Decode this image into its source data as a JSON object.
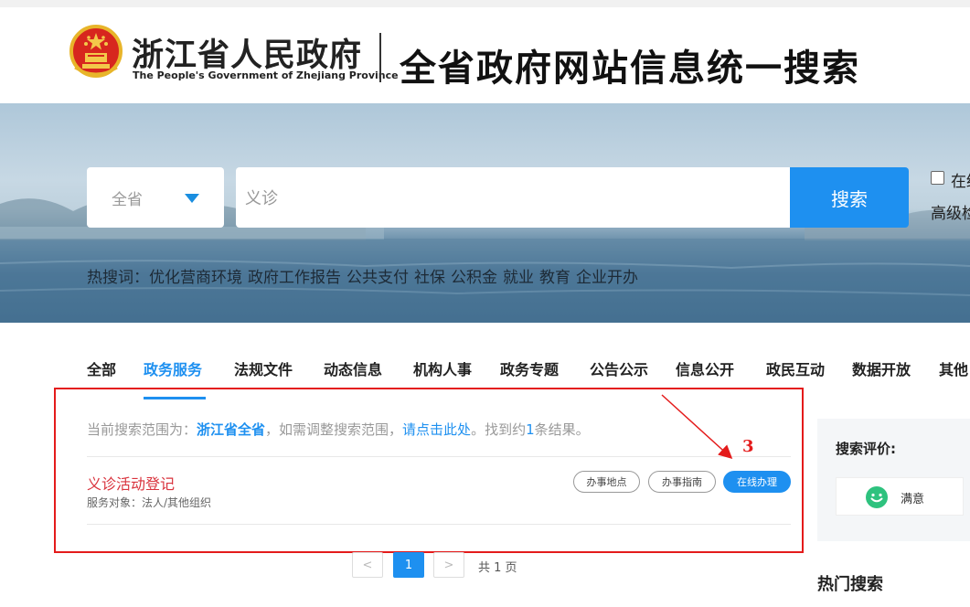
{
  "header": {
    "org_name_cn": "浙江省人民政府",
    "org_name_en": "The People's Government of Zhejiang Province",
    "site_title": "全省政府网站信息统一搜索"
  },
  "search": {
    "scope": "全省",
    "query": "义诊",
    "button_label": "搜索",
    "within_results_label": "在结果中搜索",
    "advanced_label": "高级检索"
  },
  "hot_searches": {
    "label": "热搜词：",
    "items": [
      "优化营商环境",
      "政府工作报告",
      "公共支付",
      "社保",
      "公积金",
      "就业",
      "教育",
      "企业开办"
    ]
  },
  "tabs": [
    {
      "label": "全部",
      "active": false
    },
    {
      "label": "政务服务",
      "active": true
    },
    {
      "label": "法规文件",
      "active": false
    },
    {
      "label": "动态信息",
      "active": false
    },
    {
      "label": "机构人事",
      "active": false
    },
    {
      "label": "政务专题",
      "active": false
    },
    {
      "label": "公告公示",
      "active": false
    },
    {
      "label": "信息公开",
      "active": false
    },
    {
      "label": "政民互动",
      "active": false
    },
    {
      "label": "数据开放",
      "active": false
    },
    {
      "label": "其他",
      "active": false
    }
  ],
  "results": {
    "scope_prefix": "当前搜索范围为：",
    "scope_value": "浙江省全省",
    "scope_mid": "，如需调整搜索范围，",
    "scope_link": "请点击此处",
    "found_prefix": "。找到约",
    "found_count": "1",
    "found_suffix": "条结果。",
    "items": [
      {
        "title": "义诊活动登记",
        "meta": "服务对象：法人/其他组织",
        "actions": [
          "办事地点",
          "办事指南",
          "在线办理"
        ]
      }
    ]
  },
  "pagination": {
    "prev": "<",
    "current": "1",
    "next": ">",
    "total": "共 1 页"
  },
  "sidebar": {
    "rating_title": "搜索评价:",
    "satisfied_label": "满意",
    "hot_search_title": "热门搜索"
  },
  "annotation": {
    "number": "3",
    "color": "#e41b1b"
  },
  "colors": {
    "accent": "#1e90f0",
    "result_title": "#d9333d"
  }
}
